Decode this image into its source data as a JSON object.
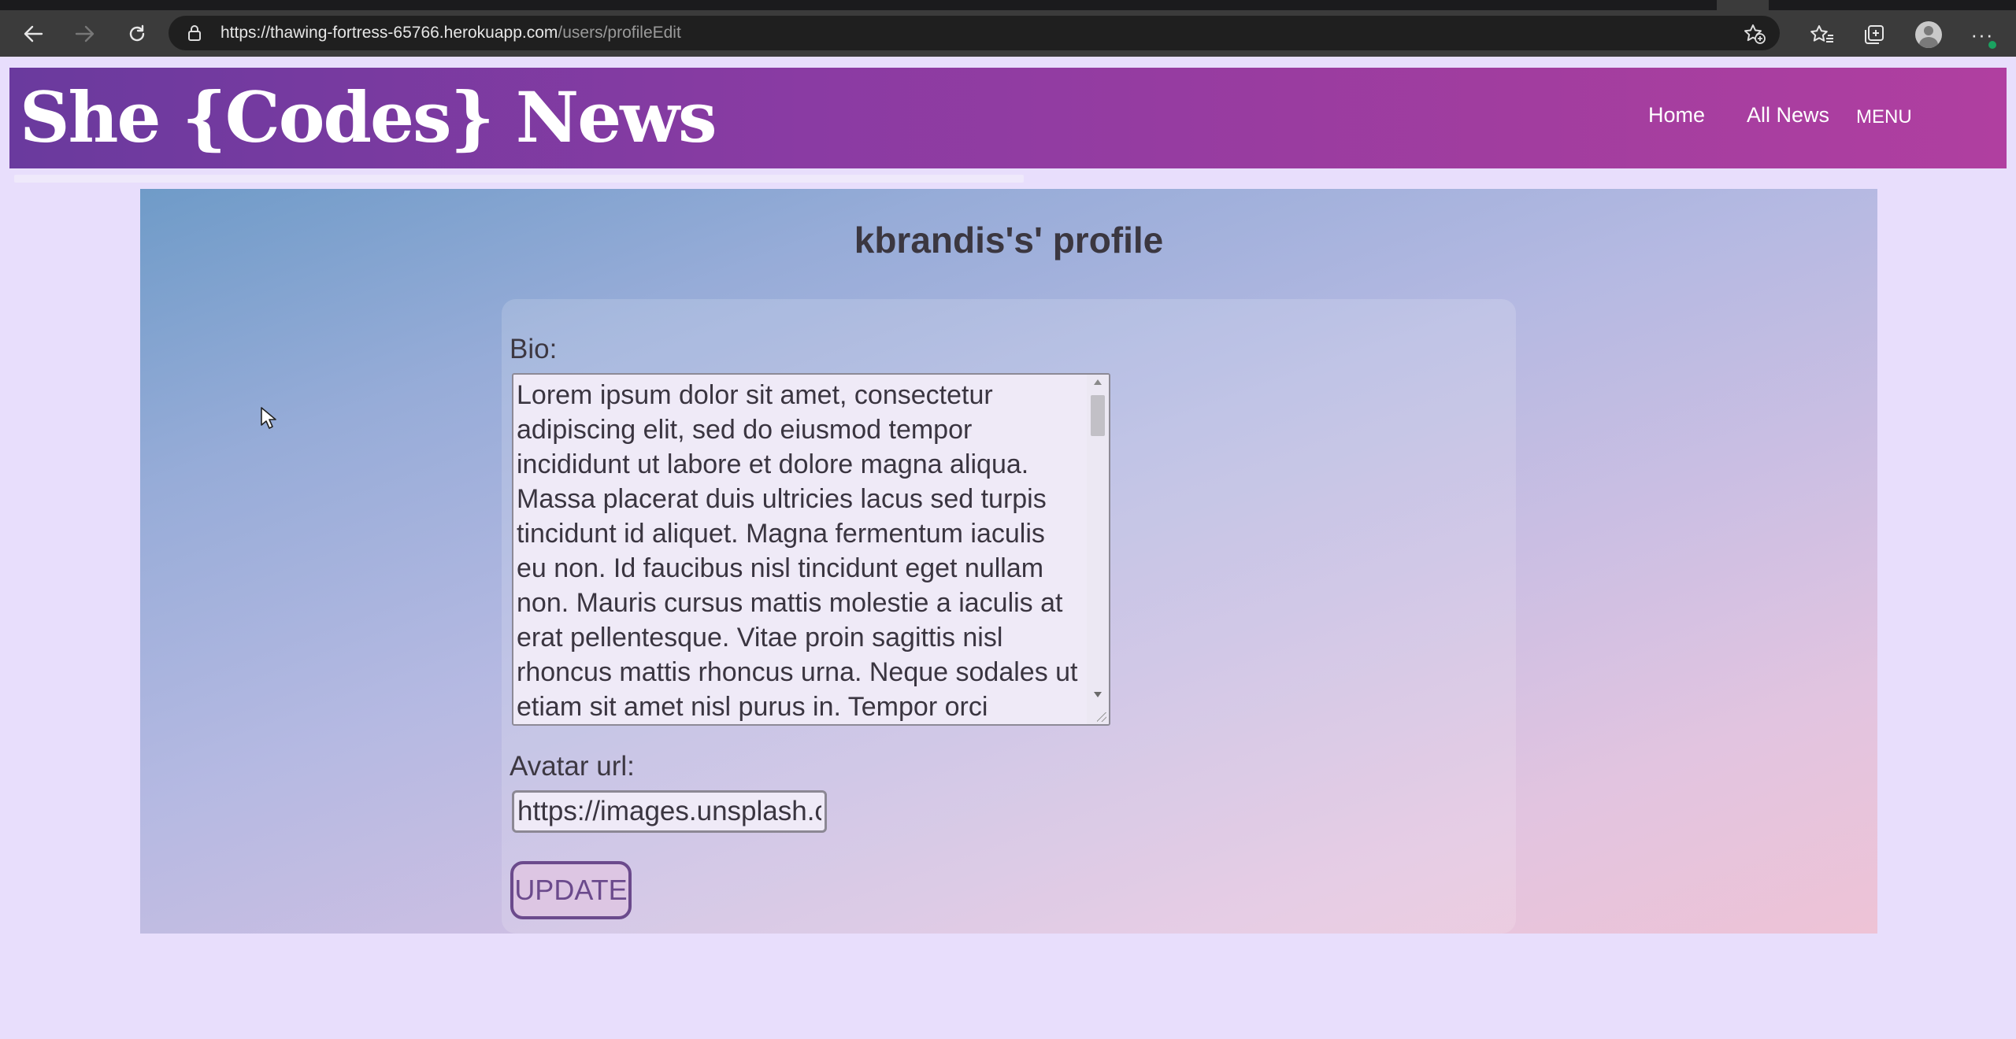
{
  "browser": {
    "url_host": "https://thawing-fortress-65766.herokuapp.com",
    "url_path": "/users/profileEdit",
    "icons": [
      "back-arrow-icon",
      "forward-arrow-icon",
      "reload-icon",
      "lock-icon",
      "add-favorite-icon",
      "favorites-icon",
      "collections-icon",
      "profile-avatar-icon",
      "more-options-icon"
    ]
  },
  "header": {
    "logo": "She {Codes} News",
    "nav": {
      "home": "Home",
      "all_news": "All News",
      "menu": "MENU"
    }
  },
  "profile": {
    "title": "kbrandis's' profile",
    "bio_label": "Bio:",
    "bio_text": "Lorem ipsum dolor sit amet, consectetur adipiscing elit, sed do eiusmod tempor incididunt ut labore et dolore magna aliqua. Massa placerat duis ultricies lacus sed turpis tincidunt id aliquet. Magna fermentum iaculis eu non. Id faucibus nisl tincidunt eget nullam non. Mauris cursus mattis molestie a iaculis at erat pellentesque. Vitae proin sagittis nisl rhoncus mattis rhoncus urna. Neque sodales ut etiam sit amet nisl purus in. Tempor orci",
    "avatar_label": "Avatar url:",
    "avatar_value": "https://images.unsplash.c",
    "update_label": "UPDATE"
  },
  "colors": {
    "page_background": "#e8defc",
    "header_gradient_start": "#6a3a9e",
    "header_gradient_end": "#b03fa0",
    "button_accent": "#6b4a8c"
  }
}
